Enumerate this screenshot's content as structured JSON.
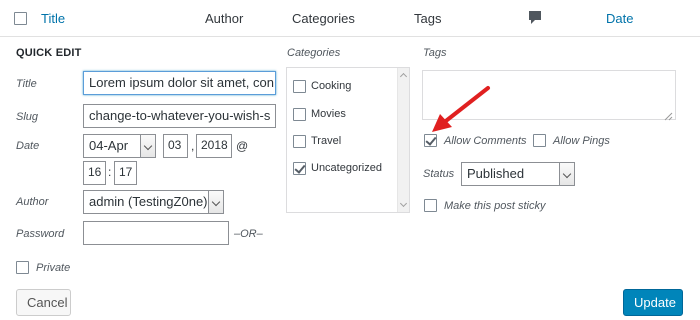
{
  "header": {
    "title": "Title",
    "author": "Author",
    "categories": "Categories",
    "tags": "Tags",
    "date": "Date",
    "comment_icon": "comment-bubble-icon"
  },
  "quick_edit": {
    "heading": "QUICK EDIT",
    "title_label": "Title",
    "title_value": "Lorem ipsum dolor sit amet, con",
    "slug_label": "Slug",
    "slug_value": "change-to-whatever-you-wish-s",
    "date_label": "Date",
    "date_month": "04-Apr",
    "date_day": "03",
    "date_sep": ",",
    "date_year": "2018",
    "date_at": "@",
    "date_hour": "16",
    "date_colon": ":",
    "date_minute": "17",
    "author_label": "Author",
    "author_value": "admin (TestingZ0ne)",
    "password_label": "Password",
    "password_value": "",
    "or_text": "–OR–",
    "private_label": "Private",
    "private_checked": false
  },
  "categories_panel": {
    "heading": "Categories",
    "items": [
      {
        "label": "Cooking",
        "checked": false
      },
      {
        "label": "Movies",
        "checked": false
      },
      {
        "label": "Travel",
        "checked": false
      },
      {
        "label": "Uncategorized",
        "checked": true
      }
    ]
  },
  "tags_panel": {
    "heading": "Tags",
    "value": "",
    "allow_comments_label": "Allow Comments",
    "allow_comments_checked": true,
    "allow_pings_label": "Allow Pings",
    "allow_pings_checked": false,
    "status_label": "Status",
    "status_value": "Published",
    "sticky_label": "Make this post sticky",
    "sticky_checked": false
  },
  "actions": {
    "cancel_label": "Cancel",
    "update_label": "Update"
  },
  "annotation": {
    "arrow_color": "#e02020"
  },
  "colors": {
    "link": "#0073aa",
    "primary_button": "#0085ba",
    "focus_border": "#5b9dd9"
  }
}
